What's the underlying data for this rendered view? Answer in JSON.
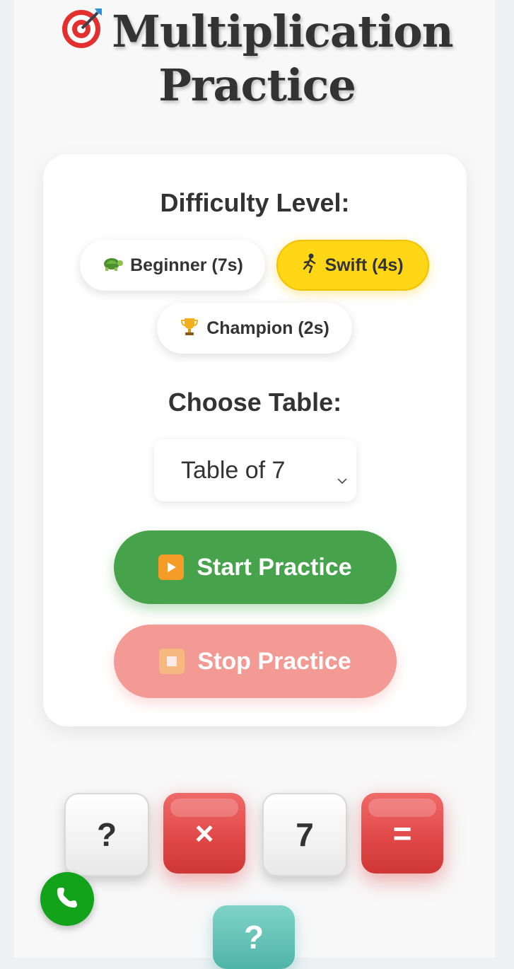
{
  "header": {
    "title_line1": "Multiplication",
    "title_line2": "Practice",
    "title_icon": "target-icon"
  },
  "difficulty": {
    "heading": "Difficulty Level:",
    "options": [
      {
        "label": "Beginner (7s)",
        "icon": "turtle-icon",
        "active": false
      },
      {
        "label": "Swift (4s)",
        "icon": "runner-icon",
        "active": true
      },
      {
        "label": "Champion (2s)",
        "icon": "trophy-icon",
        "active": false
      }
    ]
  },
  "table": {
    "heading": "Choose Table:",
    "selected": "Table of 7"
  },
  "actions": {
    "start_label": "Start Practice",
    "stop_label": "Stop Practice"
  },
  "equation": {
    "operand_a": "?",
    "operator": "×",
    "operand_b": "7",
    "equals": "=",
    "answer": "?"
  },
  "colors": {
    "accent_yellow": "#ffd716",
    "start_green": "#47a34b",
    "stop_pink": "#f29a93",
    "tile_red": "#e04646",
    "tile_teal": "#5dbfb2",
    "phone_green": "#12a31a"
  }
}
